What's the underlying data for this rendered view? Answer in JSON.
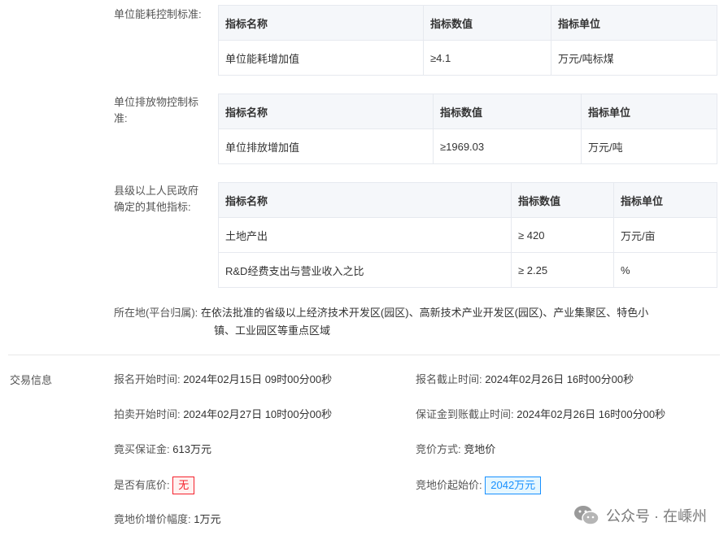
{
  "sections": {
    "energy": {
      "label": "单位能耗控制标准:",
      "headers": [
        "指标名称",
        "指标数值",
        "指标单位"
      ],
      "rows": [
        [
          "单位能耗增加值",
          "≥4.1",
          "万元/吨标煤"
        ]
      ]
    },
    "emission": {
      "label_line1": "单位排放物控制标",
      "label_line2": "准:",
      "headers": [
        "指标名称",
        "指标数值",
        "指标单位"
      ],
      "rows": [
        [
          "单位排放增加值",
          "≥1969.03",
          "万元/吨"
        ]
      ]
    },
    "other": {
      "label_line1": "县级以上人民政府",
      "label_line2": "确定的其他指标:",
      "headers": [
        "指标名称",
        "指标数值",
        "指标单位"
      ],
      "rows": [
        [
          "土地产出",
          "≥ 420",
          "万元/亩"
        ],
        [
          "R&D经费支出与营业收入之比",
          "≥ 2.25",
          "%"
        ]
      ]
    },
    "location": {
      "label": "所在地(平台归属):",
      "line1": "在依法批准的省级以上经济技术开发区(园区)、高新技术产业开发区(园区)、产业集聚区、特色小",
      "line2": "镇、工业园区等重点区域"
    }
  },
  "trade": {
    "title": "交易信息",
    "signup_start_label": "报名开始时间:",
    "signup_start": "2024年02月15日 09时00分00秒",
    "signup_end_label": "报名截止时间:",
    "signup_end": "2024年02月26日 16时00分00秒",
    "auction_start_label": "拍卖开始时间:",
    "auction_start": "2024年02月27日 10时00分00秒",
    "deposit_deadline_label": "保证金到账截止时间:",
    "deposit_deadline": "2024年02月26日 16时00分00秒",
    "deposit_label": "竟买保证金:",
    "deposit": "613万元",
    "bid_method_label": "竞价方式:",
    "bid_method": "竞地价",
    "reserve_label": "是否有底价:",
    "reserve": "无",
    "start_price_label": "竞地价起始价:",
    "start_price": "2042万元",
    "increment_label": "竟地价增价幅度:",
    "increment": "1万元"
  },
  "watermark": {
    "icon": "wechat-icon",
    "text": "公众号 · 在嵊州"
  }
}
